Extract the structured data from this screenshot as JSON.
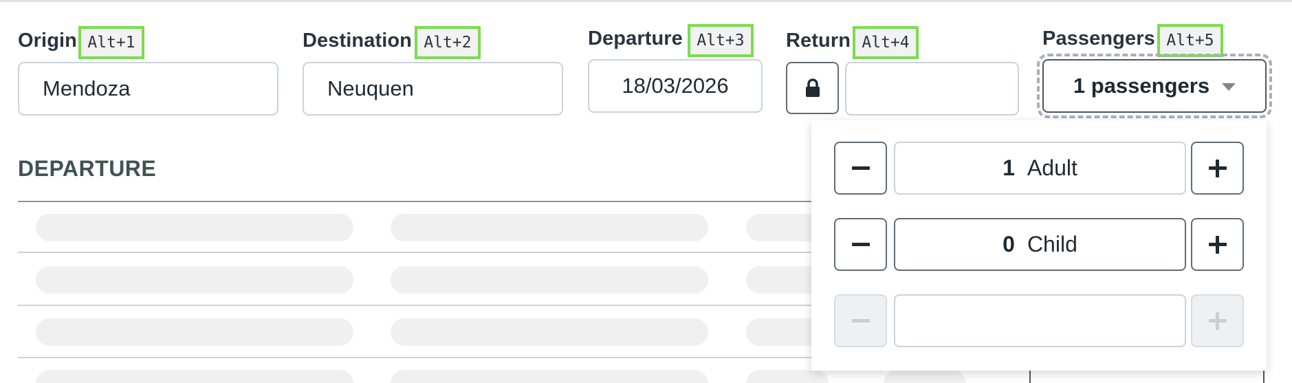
{
  "form": {
    "origin": {
      "label": "Origin",
      "shortcut": "Alt+1",
      "value": "Mendoza"
    },
    "destination": {
      "label": "Destination",
      "shortcut": "Alt+2",
      "value": "Neuquen"
    },
    "departure": {
      "label": "Departure",
      "shortcut": "Alt+3",
      "value": "18/03/2026"
    },
    "return": {
      "label": "Return",
      "shortcut": "Alt+4",
      "value": "",
      "lock_icon": "lock-icon"
    },
    "passengers": {
      "label": "Passengers",
      "shortcut": "Alt+5",
      "button_label": "1 passengers",
      "caret_icon": "caret-down-icon"
    }
  },
  "section": {
    "title": "DEPARTURE"
  },
  "passenger_panel": {
    "rows": [
      {
        "count": "1",
        "label": "Adult",
        "enabled": true
      },
      {
        "count": "0",
        "label": "Child",
        "enabled": true
      },
      {
        "count": "",
        "label": "",
        "enabled": false
      }
    ]
  },
  "colors": {
    "shortcut_highlight": "#7bdc50",
    "border": "#c9d3db",
    "section_title": "#3f5350",
    "skeleton": "#f0f0f0"
  }
}
